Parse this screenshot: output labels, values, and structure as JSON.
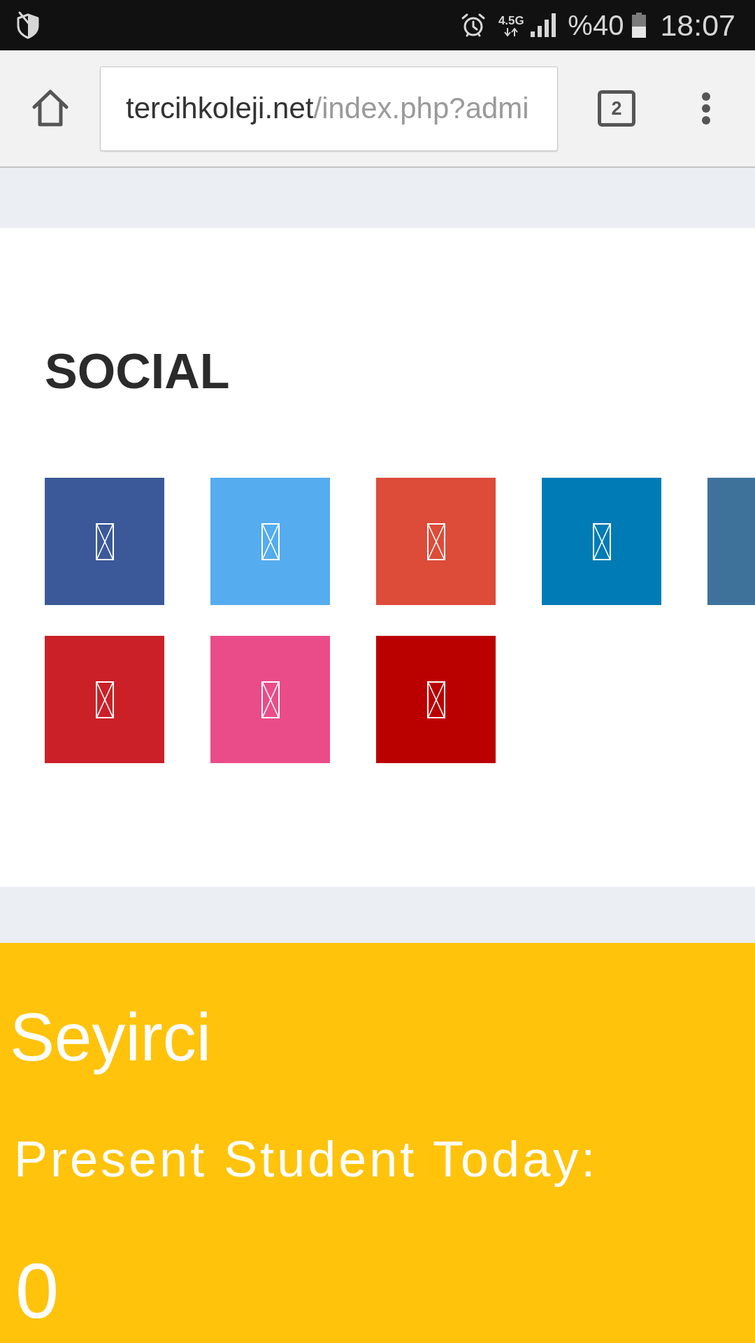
{
  "status_bar": {
    "network": "4.5G",
    "battery": "%40",
    "time": "18:07"
  },
  "browser": {
    "url": {
      "host": "tercihkoleji.net",
      "path": "/index.php?admi"
    },
    "tab_count": "2"
  },
  "social": {
    "title": "SOCIAL",
    "rows": [
      {
        "tiles": [
          {
            "kind": "icon",
            "color": "#3b5998"
          },
          {
            "kind": "icon",
            "color": "#55acee"
          },
          {
            "kind": "icon",
            "color": "#dd4b39"
          },
          {
            "kind": "icon",
            "color": "#007bb6"
          },
          {
            "kind": "partial",
            "color": "#3f729b"
          }
        ]
      },
      {
        "tiles": [
          {
            "kind": "icon",
            "color": "#cb2027"
          },
          {
            "kind": "icon",
            "color": "#ea4c89"
          },
          {
            "kind": "icon",
            "color": "#bb0000"
          }
        ]
      }
    ]
  },
  "visitors": {
    "title": "Seyirci",
    "label": "Present Student Today:",
    "count": "0"
  }
}
